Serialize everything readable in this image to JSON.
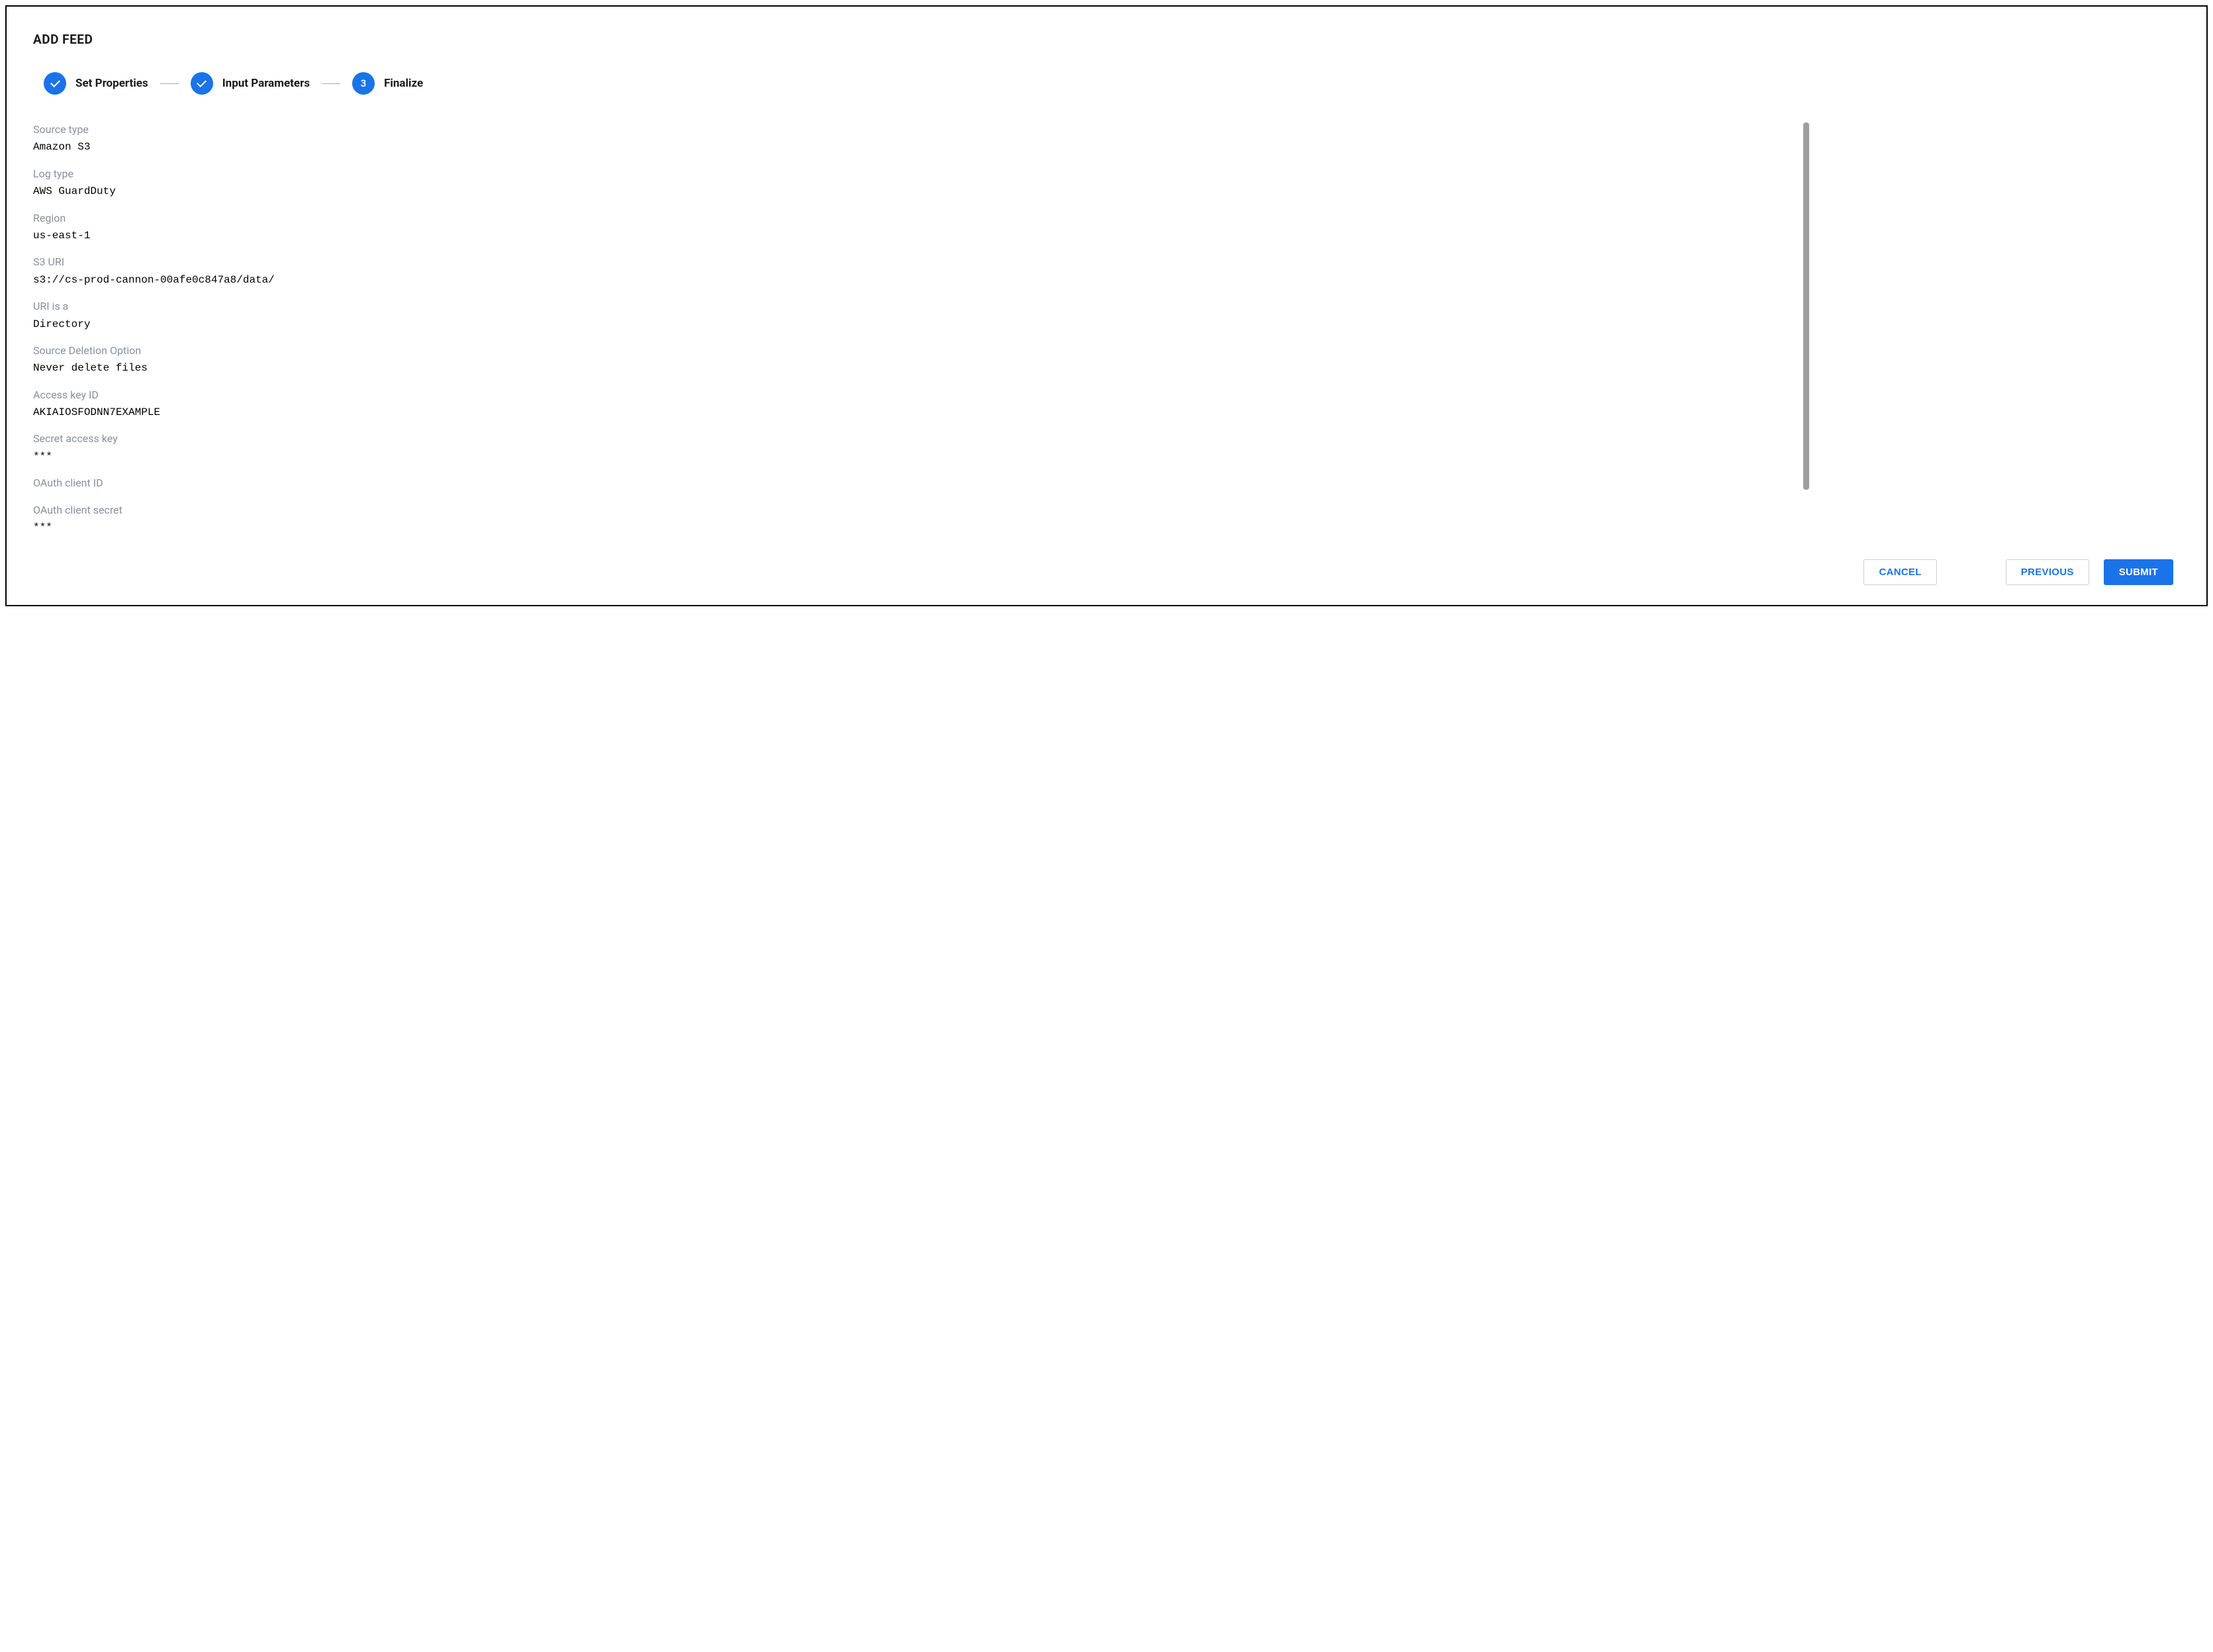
{
  "title": "ADD FEED",
  "stepper": {
    "steps": [
      {
        "label": "Set Properties",
        "state": "done",
        "indicator": "check"
      },
      {
        "label": "Input Parameters",
        "state": "done",
        "indicator": "check"
      },
      {
        "label": "Finalize",
        "state": "active",
        "indicator": "3"
      }
    ]
  },
  "fields": [
    {
      "label": "Source type",
      "value": "Amazon S3"
    },
    {
      "label": "Log type",
      "value": "AWS GuardDuty"
    },
    {
      "label": "Region",
      "value": "us-east-1"
    },
    {
      "label": "S3 URI",
      "value": "s3://cs-prod-cannon-00afe0c847a8/data/"
    },
    {
      "label": "URI is a",
      "value": "Directory"
    },
    {
      "label": "Source Deletion Option",
      "value": "Never delete files"
    },
    {
      "label": "Access key ID",
      "value": "AKIAIOSFODNN7EXAMPLE"
    },
    {
      "label": "Secret access key",
      "value": "***"
    },
    {
      "label": "OAuth client ID",
      "value": ""
    },
    {
      "label": "OAuth client secret",
      "value": "***"
    }
  ],
  "footer": {
    "cancel": "CANCEL",
    "previous": "PREVIOUS",
    "submit": "SUBMIT"
  }
}
